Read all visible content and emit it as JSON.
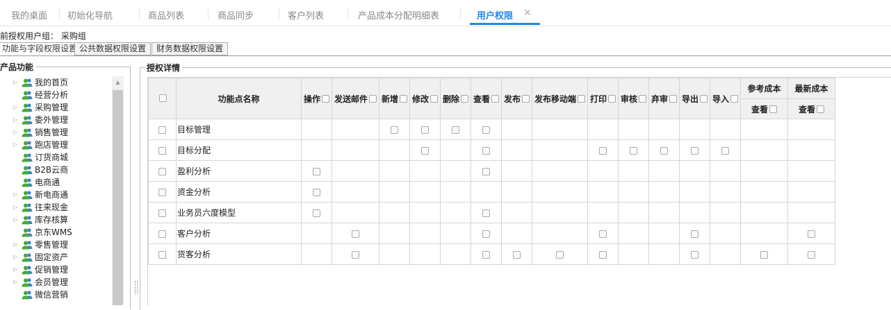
{
  "tabs": [
    {
      "label": "我的桌面"
    },
    {
      "label": "初始化导航"
    },
    {
      "label": "商品列表"
    },
    {
      "label": "商品同步"
    },
    {
      "label": "客户列表"
    },
    {
      "label": "产品成本分配明细表"
    },
    {
      "label": "用户权限",
      "active": true
    }
  ],
  "group_line": "前授权用户组： 采购组",
  "subtabs": [
    "功能与字段权限设置",
    "公共数据权限设置",
    "财务数据权限设置"
  ],
  "left_legend": "产品功能",
  "right_legend": "授权详情",
  "tree": [
    {
      "label": "我的首页",
      "expandable": true
    },
    {
      "label": "经营分析",
      "expandable": false,
      "selected": true
    },
    {
      "label": "采购管理",
      "expandable": true
    },
    {
      "label": "委外管理",
      "expandable": true
    },
    {
      "label": "销售管理",
      "expandable": true
    },
    {
      "label": "跑店管理",
      "expandable": true
    },
    {
      "label": "订货商城",
      "expandable": false
    },
    {
      "label": "B2B云商",
      "expandable": false
    },
    {
      "label": "电商通",
      "expandable": false
    },
    {
      "label": "新电商通",
      "expandable": true
    },
    {
      "label": "往来现金",
      "expandable": true
    },
    {
      "label": "库存核算",
      "expandable": true
    },
    {
      "label": "京东WMS",
      "expandable": false
    },
    {
      "label": "零售管理",
      "expandable": true
    },
    {
      "label": "固定资产",
      "expandable": true
    },
    {
      "label": "促销管理",
      "expandable": true
    },
    {
      "label": "会员管理",
      "expandable": true
    },
    {
      "label": "微信营销",
      "expandable": false
    }
  ],
  "table": {
    "name_header": "功能点名称",
    "columns": [
      "操作",
      "发送邮件",
      "新增",
      "修改",
      "删除",
      "查看",
      "发布",
      "发布移动端",
      "打印",
      "审核",
      "弃审",
      "导出",
      "导入"
    ],
    "group_columns": [
      {
        "label": "参考成本",
        "sub": "查看"
      },
      {
        "label": "最新成本",
        "sub": "查看"
      }
    ],
    "rows": [
      {
        "name": "目标管理",
        "checks": [
          0,
          0,
          1,
          1,
          1,
          1,
          0,
          0,
          0,
          0,
          0,
          0,
          0,
          0,
          0
        ]
      },
      {
        "name": "目标分配",
        "checks": [
          0,
          0,
          0,
          1,
          0,
          1,
          0,
          0,
          1,
          1,
          1,
          1,
          1,
          0,
          0
        ]
      },
      {
        "name": "盈利分析",
        "checks": [
          1,
          0,
          0,
          0,
          0,
          1,
          0,
          0,
          0,
          0,
          0,
          0,
          0,
          0,
          0
        ]
      },
      {
        "name": "资金分析",
        "checks": [
          1,
          0,
          0,
          0,
          0,
          0,
          0,
          0,
          0,
          0,
          0,
          0,
          0,
          0,
          0
        ]
      },
      {
        "name": "业务员六度模型",
        "checks": [
          1,
          0,
          0,
          0,
          0,
          1,
          0,
          0,
          0,
          0,
          0,
          0,
          0,
          0,
          0
        ]
      },
      {
        "name": "客户分析",
        "checks": [
          0,
          1,
          0,
          0,
          0,
          1,
          0,
          0,
          1,
          0,
          0,
          1,
          0,
          0,
          1
        ]
      },
      {
        "name": "货客分析",
        "checks": [
          0,
          1,
          0,
          0,
          0,
          1,
          1,
          1,
          1,
          0,
          0,
          1,
          0,
          1,
          1
        ]
      }
    ]
  },
  "colors": {
    "accent": "#1e88e5",
    "header_bg": "#f0f0f0",
    "border": "#d4d4d4"
  }
}
